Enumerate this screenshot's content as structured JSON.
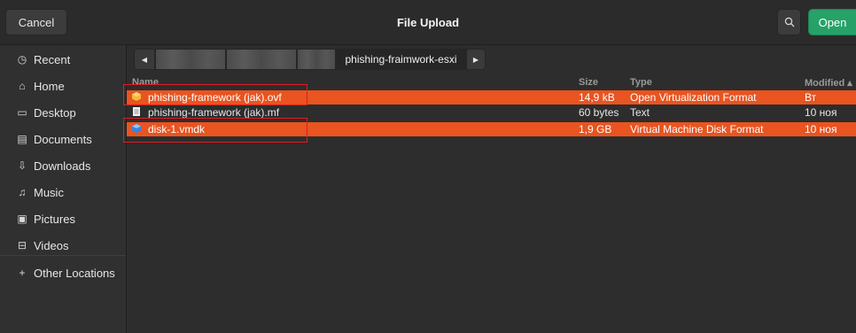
{
  "header": {
    "cancel_label": "Cancel",
    "title": "File Upload",
    "open_label": "Open"
  },
  "sidebar": {
    "items": [
      {
        "label": "Recent",
        "icon": "clock-icon"
      },
      {
        "label": "Home",
        "icon": "home-icon"
      },
      {
        "label": "Desktop",
        "icon": "desktop-icon"
      },
      {
        "label": "Documents",
        "icon": "documents-icon"
      },
      {
        "label": "Downloads",
        "icon": "download-icon"
      },
      {
        "label": "Music",
        "icon": "music-icon"
      },
      {
        "label": "Pictures",
        "icon": "pictures-icon"
      },
      {
        "label": "Videos",
        "icon": "videos-icon"
      }
    ],
    "other_locations": "Other Locations"
  },
  "pathbar": {
    "current": "phishing-fraimwork-esxi"
  },
  "columns": {
    "name": "Name",
    "size": "Size",
    "type": "Type",
    "modified": "Modified"
  },
  "files": [
    {
      "name": "phishing-framework (jak).ovf",
      "size": "14,9 kB",
      "type": "Open Virtualization Format",
      "modified": "Вт",
      "selected": true,
      "icon": "package-icon"
    },
    {
      "name": "phishing-framework (jak).mf",
      "size": "60 bytes",
      "type": "Text",
      "modified": "10 ноя",
      "selected": false,
      "icon": "text-file-icon"
    },
    {
      "name": "disk-1.vmdk",
      "size": "1,9 GB",
      "type": "Virtual Machine Disk Format",
      "modified": "10 ноя",
      "selected": true,
      "icon": "disk-image-icon"
    }
  ],
  "colors": {
    "selection": "#e95420",
    "open_button": "#26a269",
    "annotation": "#e01b24"
  }
}
